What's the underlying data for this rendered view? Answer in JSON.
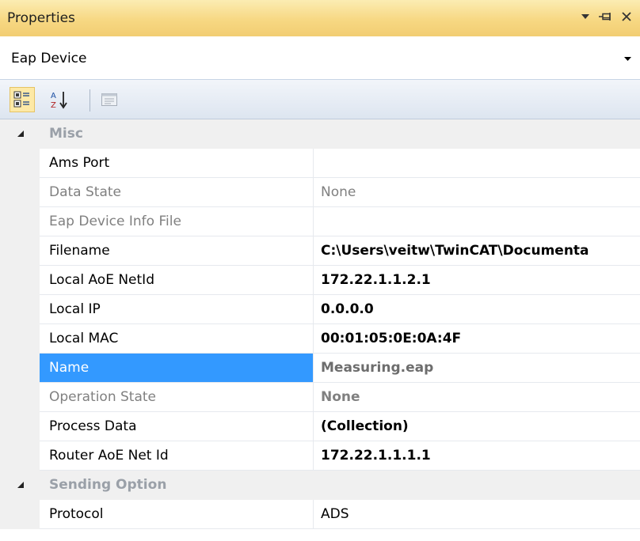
{
  "window": {
    "title": "Properties"
  },
  "object_selector": {
    "value": "Eap Device"
  },
  "toolbar": {
    "categorized_icon": "categorized-view-icon",
    "alphabetical_icon": "sort-alphabetical-icon",
    "property_pages_icon": "property-pages-icon"
  },
  "grid": {
    "categories": [
      {
        "name": "Misc",
        "properties": [
          {
            "name": "Ams Port",
            "value": ""
          },
          {
            "name": "Data State",
            "value": "None"
          },
          {
            "name": "Eap Device Info File",
            "value": ""
          },
          {
            "name": "Filename",
            "value": "C:\\Users\\veitw\\TwinCAT\\Documenta"
          },
          {
            "name": "Local AoE NetId",
            "value": "172.22.1.1.2.1"
          },
          {
            "name": "Local IP",
            "value": "0.0.0.0"
          },
          {
            "name": "Local MAC",
            "value": "00:01:05:0E:0A:4F"
          },
          {
            "name": "Name",
            "value": "Measuring.eap"
          },
          {
            "name": "Operation State",
            "value": "None"
          },
          {
            "name": "Process Data",
            "value": "(Collection)"
          },
          {
            "name": "Router AoE Net Id",
            "value": "172.22.1.1.1.1"
          }
        ]
      },
      {
        "name": "Sending Option",
        "properties": [
          {
            "name": "Protocol",
            "value": "ADS"
          }
        ]
      }
    ]
  },
  "colors": {
    "selection": "#3399ff",
    "title_gradient": "#f7d883",
    "category_bg": "#f0f0f0"
  }
}
